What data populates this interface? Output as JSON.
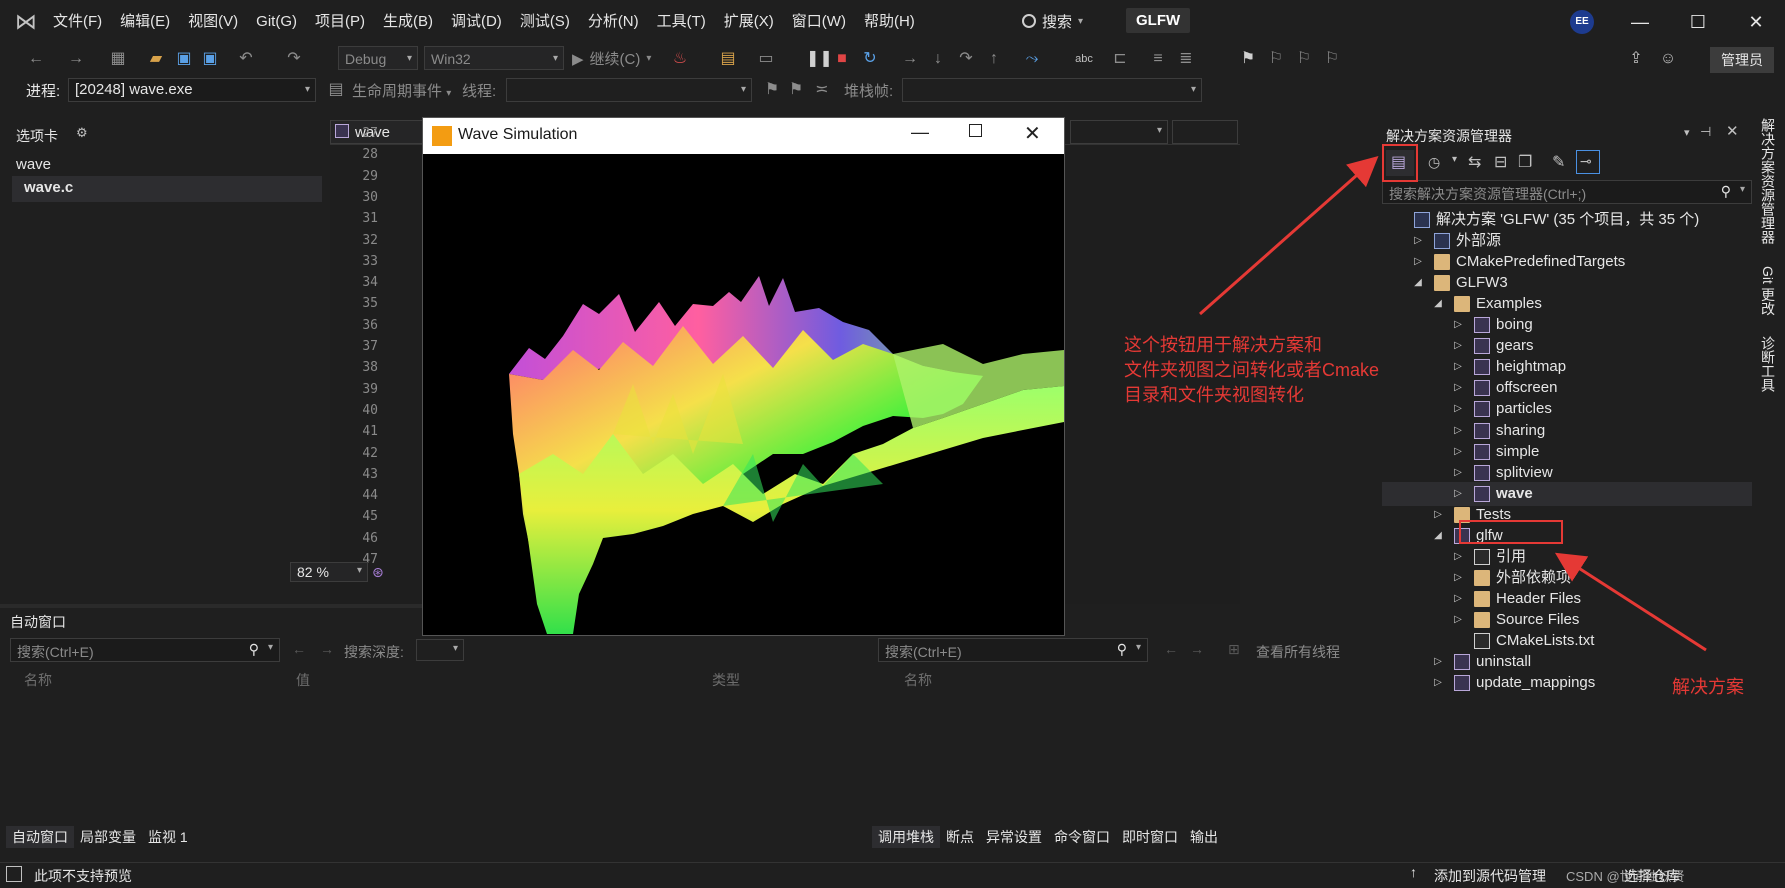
{
  "menu": [
    "文件(F)",
    "编辑(E)",
    "视图(V)",
    "Git(G)",
    "项目(P)",
    "生成(B)",
    "调试(D)",
    "测试(S)",
    "分析(N)",
    "工具(T)",
    "扩展(X)",
    "窗口(W)",
    "帮助(H)"
  ],
  "search": {
    "label": "搜索"
  },
  "solution_badge": "GLFW",
  "avatar_initials": "EE",
  "window_controls": {
    "minimize": "—",
    "maximize": "☐",
    "close": "✕"
  },
  "toolbar": {
    "config": "Debug",
    "platform": "Win32",
    "continue_label": "继续(C)",
    "admin_label": "管理员"
  },
  "debug_location": {
    "process_label": "进程:",
    "process_value": "[20248] wave.exe",
    "lifecycle_label": "生命周期事件",
    "thread_label": "线程:",
    "stackframe_label": "堆栈帧:"
  },
  "left_panel": {
    "title": "选项卡",
    "items": [
      "wave",
      "wave.c"
    ]
  },
  "editor": {
    "tab_label": "wave",
    "line_numbers": [
      "27",
      "28",
      "29",
      "30",
      "31",
      "32",
      "33",
      "34",
      "35",
      "36",
      "37",
      "38",
      "39",
      "40",
      "41",
      "42",
      "43",
      "44",
      "45",
      "46",
      "47"
    ],
    "zoom": "82 %"
  },
  "wave_window": {
    "title": "Wave Simulation"
  },
  "autos_panel": {
    "title": "自动窗口",
    "search_placeholder": "搜索(Ctrl+E)",
    "search_depth_label": "搜索深度:",
    "columns": [
      "名称",
      "值",
      "类型"
    ]
  },
  "callstack_panel": {
    "search_placeholder": "搜索(Ctrl+E)",
    "view_all_threads": "查看所有线程",
    "columns": [
      "名称"
    ]
  },
  "bottom_tabs_left": [
    "自动窗口",
    "局部变量",
    "监视 1"
  ],
  "bottom_tabs_right": [
    "调用堆栈",
    "断点",
    "异常设置",
    "命令窗口",
    "即时窗口",
    "输出"
  ],
  "solution_explorer": {
    "title": "解决方案资源管理器",
    "search_placeholder": "搜索解决方案资源管理器(Ctrl+;)",
    "tree": [
      {
        "label": "解决方案 'GLFW' (35 个项目，共 35 个)",
        "depth": 0,
        "icon": "solution",
        "arrow": ""
      },
      {
        "label": "外部源",
        "depth": 1,
        "icon": "external-source",
        "arrow": "closed"
      },
      {
        "label": "CMakePredefinedTargets",
        "depth": 1,
        "icon": "folder",
        "arrow": "closed"
      },
      {
        "label": "GLFW3",
        "depth": 1,
        "icon": "folder",
        "arrow": "open"
      },
      {
        "label": "Examples",
        "depth": 2,
        "icon": "folder",
        "arrow": "open"
      },
      {
        "label": "boing",
        "depth": 3,
        "icon": "project",
        "arrow": "closed"
      },
      {
        "label": "gears",
        "depth": 3,
        "icon": "project",
        "arrow": "closed"
      },
      {
        "label": "heightmap",
        "depth": 3,
        "icon": "project",
        "arrow": "closed"
      },
      {
        "label": "offscreen",
        "depth": 3,
        "icon": "project",
        "arrow": "closed"
      },
      {
        "label": "particles",
        "depth": 3,
        "icon": "project",
        "arrow": "closed"
      },
      {
        "label": "sharing",
        "depth": 3,
        "icon": "project",
        "arrow": "closed"
      },
      {
        "label": "simple",
        "depth": 3,
        "icon": "project",
        "arrow": "closed"
      },
      {
        "label": "splitview",
        "depth": 3,
        "icon": "project",
        "arrow": "closed"
      },
      {
        "label": "wave",
        "depth": 3,
        "icon": "project",
        "arrow": "closed",
        "bold": true,
        "selected": true
      },
      {
        "label": "Tests",
        "depth": 2,
        "icon": "folder",
        "arrow": "closed"
      },
      {
        "label": "glfw",
        "depth": 2,
        "icon": "project",
        "arrow": "open"
      },
      {
        "label": "引用",
        "depth": 3,
        "icon": "references",
        "arrow": "closed"
      },
      {
        "label": "外部依赖项",
        "depth": 3,
        "icon": "external-deps",
        "arrow": "closed"
      },
      {
        "label": "Header Files",
        "depth": 3,
        "icon": "filter-folder",
        "arrow": "closed"
      },
      {
        "label": "Source Files",
        "depth": 3,
        "icon": "filter-folder",
        "arrow": "closed"
      },
      {
        "label": "CMakeLists.txt",
        "depth": 3,
        "icon": "file",
        "arrow": ""
      },
      {
        "label": "uninstall",
        "depth": 2,
        "icon": "project",
        "arrow": "closed"
      },
      {
        "label": "update_mappings",
        "depth": 2,
        "icon": "project",
        "arrow": "closed"
      }
    ]
  },
  "side_tabs": [
    "解决方案资源管理器",
    "Git 更改",
    "诊断工具"
  ],
  "annotations": {
    "switch_views_note": [
      "这个按钮用于解决方案和",
      "文件夹视图之间转化或者Cmake",
      "目录和文件夹视图转化"
    ],
    "solution_note": "解决方案",
    "color": "#e53935"
  },
  "status": {
    "left": "此项不支持预览",
    "add_to_source_control": "添加到源代码管理",
    "select_repo": "选择仓库",
    "watermark": "CSDN @世间浊妖贤"
  }
}
